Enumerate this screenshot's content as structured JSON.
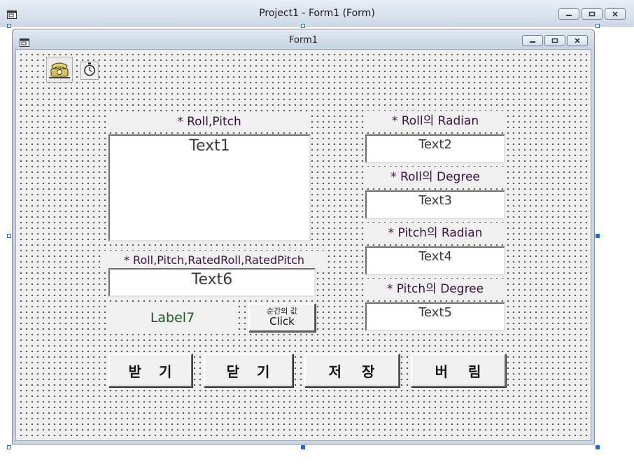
{
  "window": {
    "title": "Project1 - Form1 (Form)"
  },
  "form": {
    "title": "Form1"
  },
  "icons": {
    "system_menu": "form-system-icon",
    "minimize": "minimize-icon",
    "maximize": "maximize-icon",
    "close": "close-icon",
    "control_telephone": "telephone-icon",
    "control_timer": "stopwatch-icon"
  },
  "labels": {
    "roll_pitch": "* Roll,Pitch",
    "roll_radian": "* Roll의 Radian",
    "roll_degree": "* Roll의 Degree",
    "pitch_radian": "* Pitch의 Radian",
    "pitch_degree": "* Pitch의 Degree",
    "rated": "* Roll,Pitch,RatedRoll,RatedPitch",
    "label7": "Label7"
  },
  "textboxes": {
    "text1": "Text1",
    "text2": "Text2",
    "text3": "Text3",
    "text4": "Text4",
    "text5": "Text5",
    "text6": "Text6"
  },
  "buttons": {
    "click_caption_top": "순간의 값",
    "click_caption_bottom": "Click",
    "receive": "받 기",
    "close": "닫 기",
    "save": "저 장",
    "discard": "버 림"
  },
  "colors": {
    "label_text": "#3c1040",
    "label7_text": "#1f5d1f",
    "selection_handle": "#1d6cd8"
  }
}
